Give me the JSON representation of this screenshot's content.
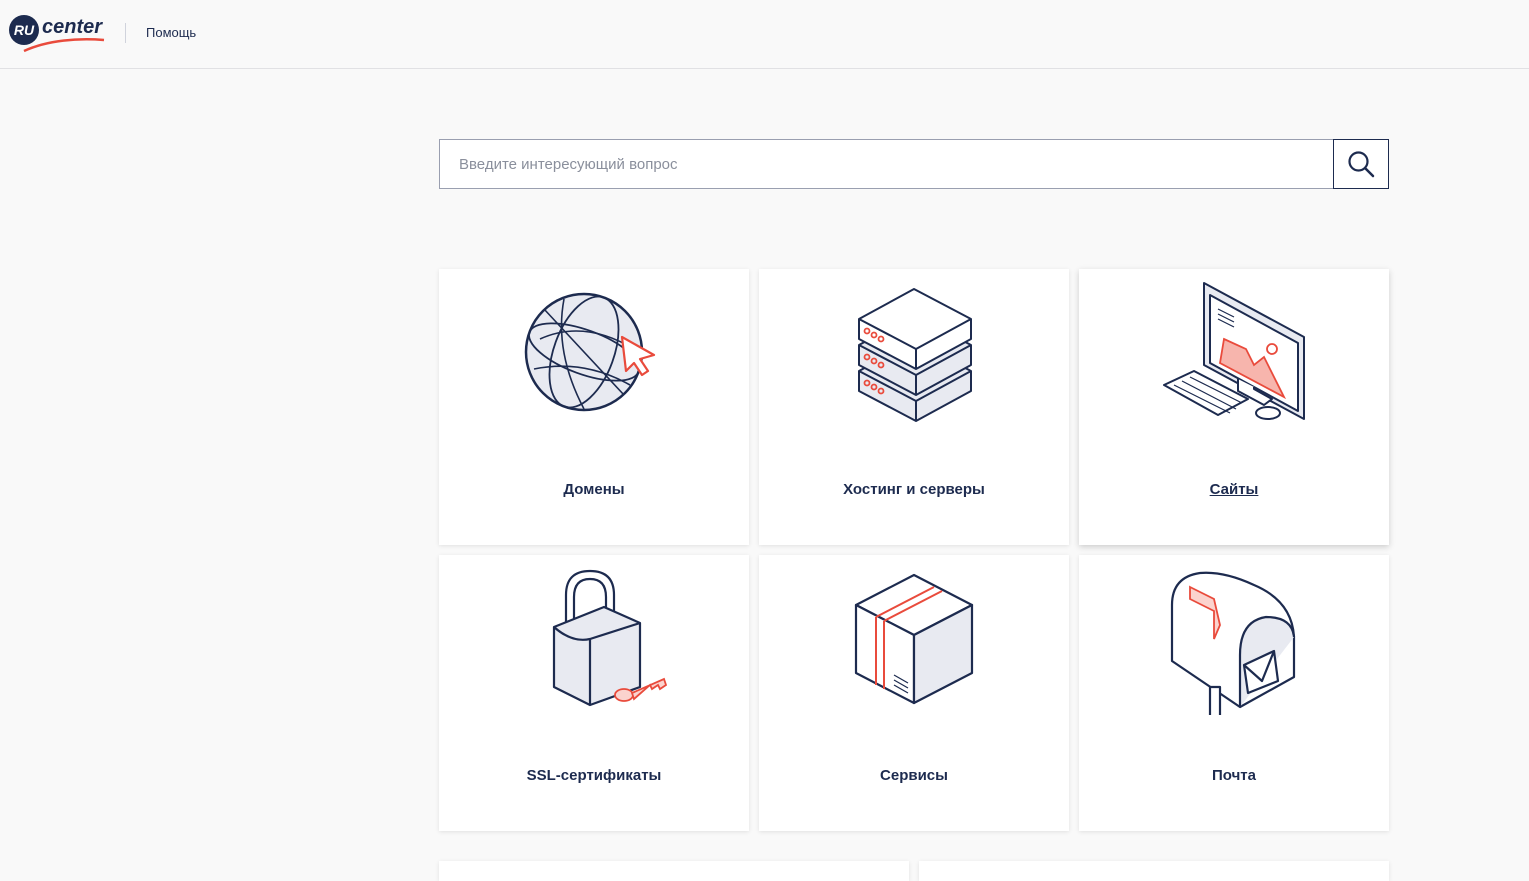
{
  "header": {
    "logo_badge": "RU",
    "logo_text": "center",
    "help_link": "Помощь"
  },
  "search": {
    "placeholder": "Введите интересующий вопрос"
  },
  "categories": [
    {
      "label": "Домены",
      "icon": "globe-cursor-icon"
    },
    {
      "label": "Хостинг и серверы",
      "icon": "server-stack-icon"
    },
    {
      "label": "Сайты",
      "icon": "computer-monitor-icon"
    },
    {
      "label": "SSL-сертификаты",
      "icon": "padlock-key-icon"
    },
    {
      "label": "Сервисы",
      "icon": "box-package-icon"
    },
    {
      "label": "Почта",
      "icon": "mailbox-icon"
    }
  ],
  "colors": {
    "navy": "#1d2b4f",
    "accent": "#e94b3c",
    "background": "#f9f9f9"
  }
}
